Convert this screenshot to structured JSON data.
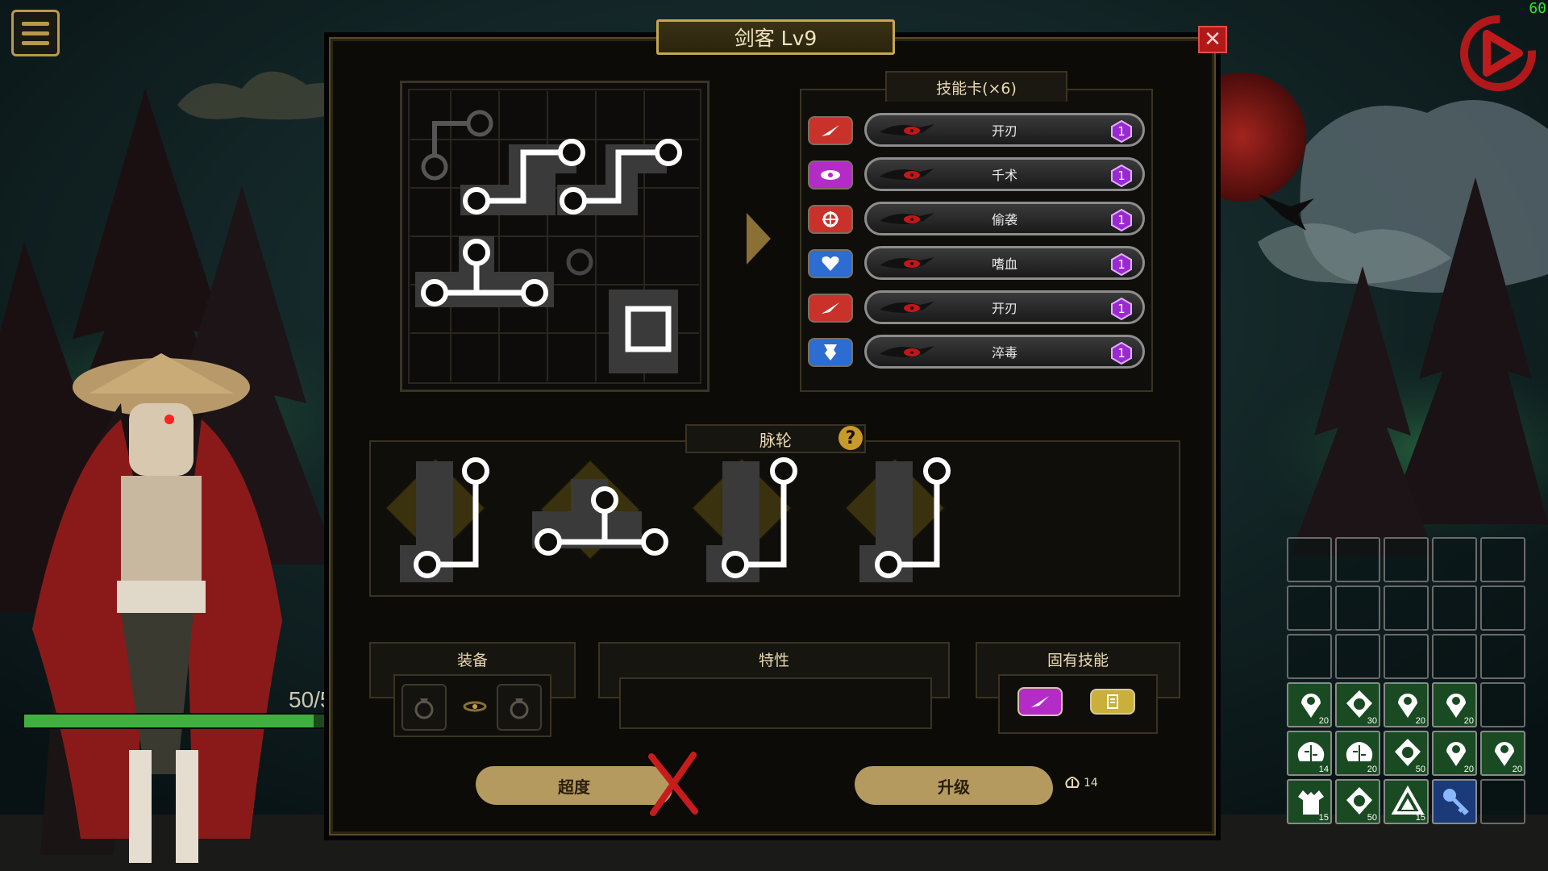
{
  "title": "剑客 Lv9",
  "fps": "60",
  "hero": {
    "hp_text": "50/5",
    "hp_fraction": 0.92
  },
  "skill_cards": {
    "header": "技能卡(×6)",
    "items": [
      {
        "name": "开刃",
        "icon": "blade-icon",
        "color": "#c8322a",
        "level": "1"
      },
      {
        "name": "千术",
        "icon": "eye-icon",
        "color": "#b42cc8",
        "level": "1"
      },
      {
        "name": "偷袭",
        "icon": "target-icon",
        "color": "#c8322a",
        "level": "1"
      },
      {
        "name": "嗜血",
        "icon": "heart-icon",
        "color": "#2d6cd0",
        "level": "1"
      },
      {
        "name": "开刃",
        "icon": "blade-icon",
        "color": "#c8322a",
        "level": "1"
      },
      {
        "name": "淬毒",
        "icon": "poison-icon",
        "color": "#2d6cd0",
        "level": "1"
      }
    ]
  },
  "meridian": {
    "header": "脉轮",
    "help": "?"
  },
  "sections": {
    "equipment": "装备",
    "traits": "特性",
    "innate": "固有技能"
  },
  "buttons": {
    "transcend": "超度",
    "upgrade": "升级"
  },
  "upgrade_cost": "14",
  "inventory": [
    {
      "icon": "pin-icon",
      "count": "20"
    },
    {
      "icon": "ring-icon",
      "count": "30"
    },
    {
      "icon": "pin-icon",
      "count": "20"
    },
    {
      "icon": "pin-icon",
      "count": "20"
    },
    {
      "icon": "",
      "count": ""
    },
    {
      "icon": "brain-icon",
      "count": "14"
    },
    {
      "icon": "brain-icon",
      "count": "20"
    },
    {
      "icon": "ring-icon",
      "count": "50"
    },
    {
      "icon": "pin-icon",
      "count": "20"
    },
    {
      "icon": "pin-icon",
      "count": "20"
    },
    {
      "icon": "vest-icon",
      "count": "15"
    },
    {
      "icon": "ring-icon",
      "count": "50"
    },
    {
      "icon": "triangle-icon",
      "count": "15"
    },
    {
      "icon": "key-icon",
      "count": ""
    },
    {
      "icon": "",
      "count": ""
    }
  ]
}
